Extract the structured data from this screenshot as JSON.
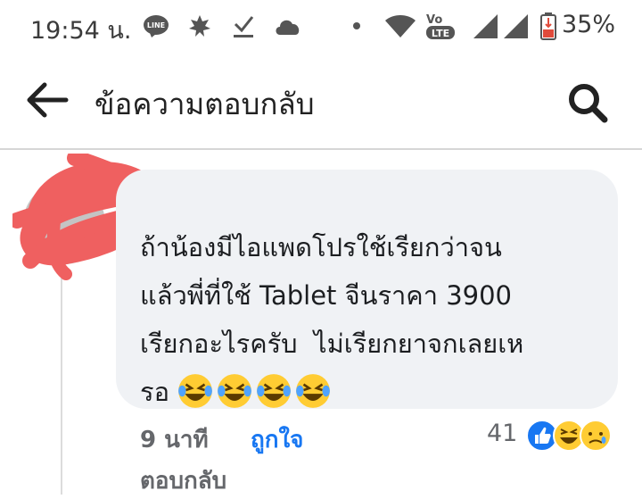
{
  "status_bar": {
    "time": "19:54 น.",
    "battery": "35%",
    "icons": [
      "line-icon",
      "leaf-icon",
      "download-done-icon",
      "cloud-icon",
      "dot-icon",
      "wifi-icon",
      "volte-icon",
      "signal-icon",
      "signal-2-icon",
      "battery-icon"
    ],
    "volte_label": "Vo",
    "lte_label": "LTE",
    "line_label": "LINE"
  },
  "header": {
    "title": "ข้อความตอบกลับ",
    "back_icon": "arrow-left-icon",
    "search_icon": "search-icon"
  },
  "comment": {
    "text": "ถ้าน้องมีไอแพดโปรใช้เรียกว่าจน\nแล้วพี่ที่ใช้ Tablet จีนราคา 3900\nเรียกอะไรครับ  ไม่เรียกยาจกเลยเห\nรอ",
    "emojis": [
      "rolling-on-floor-laughing",
      "rolling-on-floor-laughing",
      "rolling-on-floor-laughing",
      "rolling-on-floor-laughing"
    ],
    "time_ago": "9 นาที",
    "like_label": "ถูกใจ",
    "reply_label": "ตอบกลับ",
    "reaction_count": "41",
    "reactions": [
      "like",
      "haha",
      "sad"
    ]
  },
  "colors": {
    "accent": "#1877f2",
    "bubble": "#f0f2f5",
    "muted": "#65676b",
    "redaction": "#ef6060"
  }
}
